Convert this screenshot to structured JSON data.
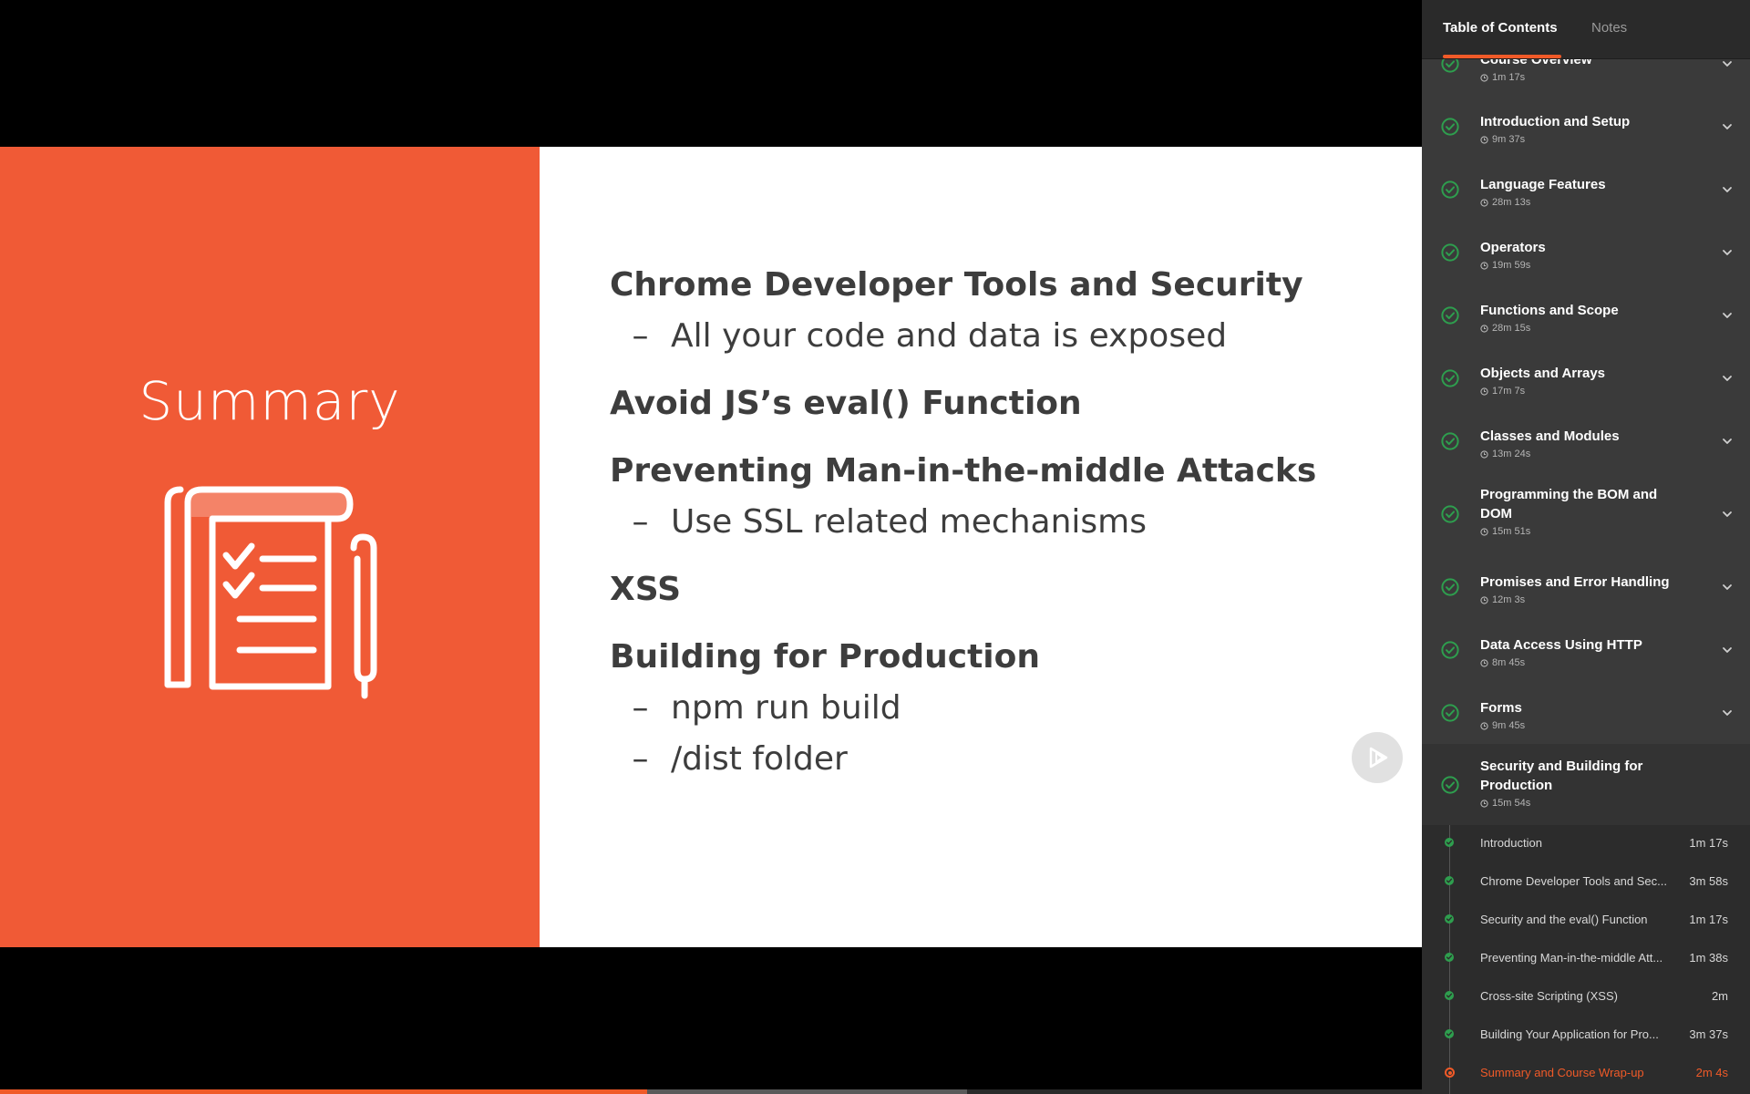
{
  "slide": {
    "title": "Summary",
    "sections": [
      {
        "heading": "Chrome Developer Tools and Security",
        "points": [
          "All your code and data is exposed"
        ]
      },
      {
        "heading": "Avoid JS’s eval() Function",
        "points": []
      },
      {
        "heading": "Preventing Man-in-the-middle Attacks",
        "points": [
          "Use SSL related mechanisms"
        ]
      },
      {
        "heading": "XSS",
        "points": []
      },
      {
        "heading": "Building for Production",
        "points": [
          "npm run build",
          "/dist folder"
        ]
      }
    ],
    "bullet_char": "–"
  },
  "progress": {
    "played_fraction": 0.455,
    "buffered_fraction": 0.68
  },
  "sidebar": {
    "tabs": {
      "toc": "Table of Contents",
      "notes": "Notes"
    },
    "modules": [
      {
        "title": "Course Overview",
        "duration": "1m 17s",
        "completed": true
      },
      {
        "title": "Introduction and Setup",
        "duration": "9m 37s",
        "completed": true
      },
      {
        "title": "Language Features",
        "duration": "28m 13s",
        "completed": true
      },
      {
        "title": "Operators",
        "duration": "19m 59s",
        "completed": true
      },
      {
        "title": "Functions and Scope",
        "duration": "28m 15s",
        "completed": true
      },
      {
        "title": "Objects and Arrays",
        "duration": "17m 7s",
        "completed": true
      },
      {
        "title": "Classes and Modules",
        "duration": "13m 24s",
        "completed": true
      },
      {
        "title": "Programming the BOM and DOM",
        "duration": "15m 51s",
        "completed": true
      },
      {
        "title": "Promises and Error Handling",
        "duration": "12m 3s",
        "completed": true
      },
      {
        "title": "Data Access Using HTTP",
        "duration": "8m 45s",
        "completed": true
      },
      {
        "title": "Forms",
        "duration": "9m 45s",
        "completed": true
      },
      {
        "title": "Security and Building for Production",
        "duration": "15m 54s",
        "completed": true,
        "expanded": true
      }
    ],
    "clips": [
      {
        "title": "Introduction",
        "duration": "1m 17s",
        "status": "watched"
      },
      {
        "title": "Chrome Developer Tools and Sec...",
        "duration": "3m 58s",
        "status": "watched"
      },
      {
        "title": "Security and the eval() Function",
        "duration": "1m 17s",
        "status": "watched"
      },
      {
        "title": "Preventing Man-in-the-middle Att...",
        "duration": "1m 38s",
        "status": "watched"
      },
      {
        "title": "Cross-site Scripting (XSS)",
        "duration": "2m",
        "status": "watched"
      },
      {
        "title": "Building Your Application for Pro...",
        "duration": "3m 37s",
        "status": "watched"
      },
      {
        "title": "Summary and Course Wrap-up",
        "duration": "2m 4s",
        "status": "current"
      }
    ]
  },
  "colors": {
    "accent": "#f05a28",
    "slide_panel": "#f05a36",
    "check_green": "#2e9e4e",
    "sidebar_bg": "#3a3a3a"
  }
}
